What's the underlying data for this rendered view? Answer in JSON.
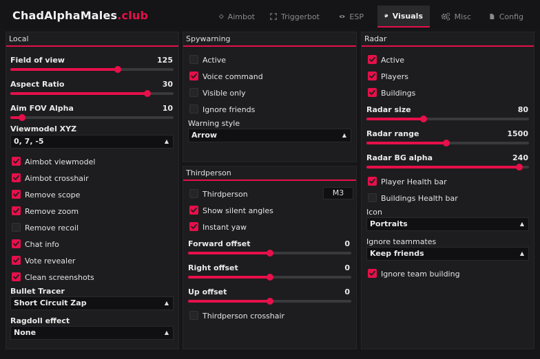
{
  "brand": {
    "name": "ChadAlphaMales",
    "suffix": ".club"
  },
  "colors": {
    "accent": "#e6104a",
    "background": "#161618",
    "panel": "#1d1d1f"
  },
  "tabs": [
    {
      "label": "Aimbot",
      "icon": "crosshair-icon",
      "active": false
    },
    {
      "label": "Triggerbot",
      "icon": "corners-icon",
      "active": false
    },
    {
      "label": "ESP",
      "icon": "eye-icon",
      "active": false
    },
    {
      "label": "Visuals",
      "icon": "palette-icon",
      "active": true
    },
    {
      "label": "Misc",
      "icon": "gears-icon",
      "active": false
    },
    {
      "label": "Config",
      "icon": "file-icon",
      "active": false
    }
  ],
  "local": {
    "title": "Local",
    "sliders": [
      {
        "label": "Field of view",
        "value": "125",
        "fraction": 0.66
      },
      {
        "label": "Aspect Ratio",
        "value": "30",
        "fraction": 0.84
      },
      {
        "label": "Aim FOV Alpha",
        "value": "10",
        "fraction": 0.07
      }
    ],
    "viewmodel": {
      "label": "Viewmodel XYZ",
      "value": "0, 7, -5"
    },
    "checkboxes": [
      {
        "label": "Aimbot viewmodel",
        "checked": true
      },
      {
        "label": "Aimbot crosshair",
        "checked": true
      },
      {
        "label": "Remove scope",
        "checked": true
      },
      {
        "label": "Remove zoom",
        "checked": true
      },
      {
        "label": "Remove recoil",
        "checked": false
      },
      {
        "label": "Chat info",
        "checked": true
      },
      {
        "label": "Vote revealer",
        "checked": true
      },
      {
        "label": "Clean screenshots",
        "checked": true
      }
    ],
    "bullet_tracer": {
      "label": "Bullet Tracer",
      "value": "Short Circuit Zap"
    },
    "ragdoll": {
      "label": "Ragdoll effect",
      "value": "None"
    }
  },
  "spywarning": {
    "title": "Spywarning",
    "checkboxes": [
      {
        "label": "Active",
        "checked": false
      },
      {
        "label": "Voice command",
        "checked": true
      },
      {
        "label": "Visible only",
        "checked": false
      },
      {
        "label": "Ignore friends",
        "checked": false
      }
    ],
    "style": {
      "label": "Warning style",
      "value": "Arrow"
    }
  },
  "thirdperson": {
    "title": "Thirdperson",
    "toggle": {
      "label": "Thirdperson",
      "checked": false,
      "key": "M3"
    },
    "checkboxes": [
      {
        "label": "Show silent angles",
        "checked": true
      },
      {
        "label": "Instant yaw",
        "checked": true
      }
    ],
    "sliders": [
      {
        "label": "Forward offset",
        "value": "0",
        "fraction": 0.5
      },
      {
        "label": "Right offset",
        "value": "0",
        "fraction": 0.5
      },
      {
        "label": "Up offset",
        "value": "0",
        "fraction": 0.5
      }
    ],
    "crosshair": {
      "label": "Thirdperson crosshair",
      "checked": false
    }
  },
  "radar": {
    "title": "Radar",
    "checkboxes": [
      {
        "label": "Active",
        "checked": true
      },
      {
        "label": "Players",
        "checked": true
      },
      {
        "label": "Buildings",
        "checked": true
      }
    ],
    "sliders": [
      {
        "label": "Radar size",
        "value": "80",
        "fraction": 0.35
      },
      {
        "label": "Radar range",
        "value": "1500",
        "fraction": 0.49
      },
      {
        "label": "Radar BG alpha",
        "value": "240",
        "fraction": 0.94
      }
    ],
    "checkboxes2": [
      {
        "label": "Player Health bar",
        "checked": true
      },
      {
        "label": "Buildings Health bar",
        "checked": false
      }
    ],
    "icon": {
      "label": "Icon",
      "value": "Portraits"
    },
    "ignore_teammates": {
      "label": "Ignore teammates",
      "value": "Keep friends"
    },
    "ignore_building": {
      "label": "Ignore team building",
      "checked": true
    }
  }
}
